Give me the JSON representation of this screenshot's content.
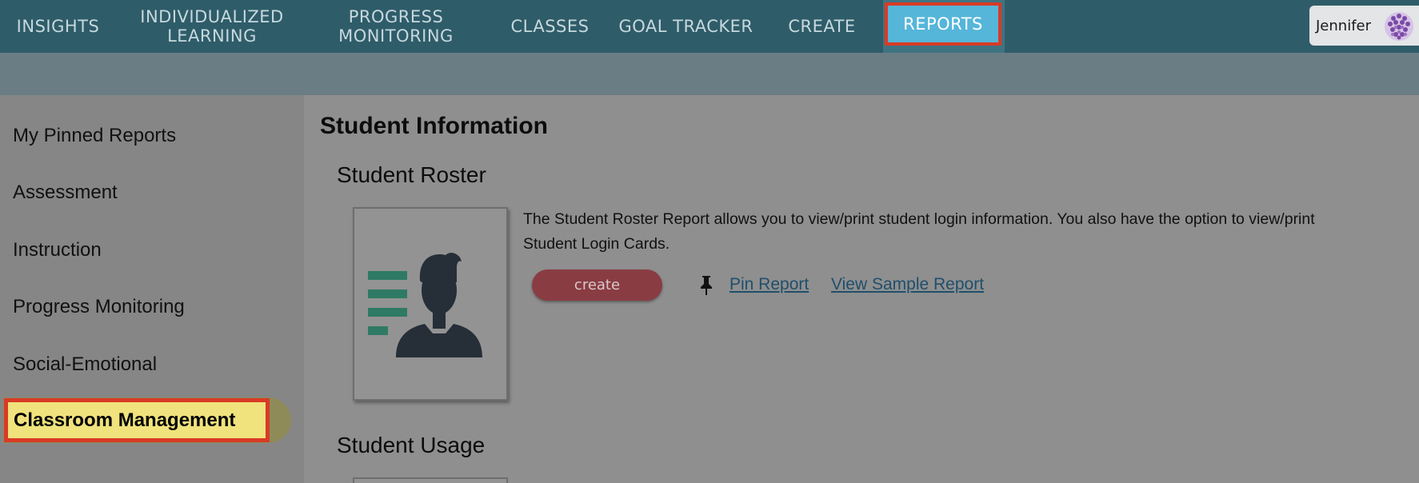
{
  "nav": {
    "items": [
      {
        "label": "INSIGHTS"
      },
      {
        "label": "INDIVIDUALIZED\nLEARNING"
      },
      {
        "label": "PROGRESS\nMONITORING"
      },
      {
        "label": "CLASSES"
      },
      {
        "label": "GOAL TRACKER"
      },
      {
        "label": "CREATE"
      },
      {
        "label": "REPORTS"
      }
    ],
    "user_name": "Jennifer"
  },
  "sidebar": {
    "items": [
      {
        "label": "My Pinned Reports"
      },
      {
        "label": "Assessment"
      },
      {
        "label": "Instruction"
      },
      {
        "label": "Progress Monitoring"
      },
      {
        "label": "Social-Emotional"
      },
      {
        "label": "Classroom Management"
      }
    ]
  },
  "main": {
    "section_title": "Student Information",
    "reports": [
      {
        "title": "Student Roster",
        "description": "The Student Roster Report allows you to view/print student login information. You also have the option to view/print Student Login Cards.",
        "create_label": "create",
        "pin_label": "Pin Report",
        "sample_label": "View Sample Report"
      },
      {
        "title": "Student Usage"
      }
    ]
  },
  "colors": {
    "nav_bg": "#2f5c69",
    "active_tab": "#55b6d9",
    "highlight_outline": "#d93a26",
    "active_side_item": "#f0e27c",
    "create_button": "#8a3c43",
    "link": "#1f4f6c"
  },
  "icons": {
    "avatar": "purple-pattern-avatar",
    "pin": "pushpin-icon",
    "thumbnail": "student-roster-thumbnail"
  }
}
